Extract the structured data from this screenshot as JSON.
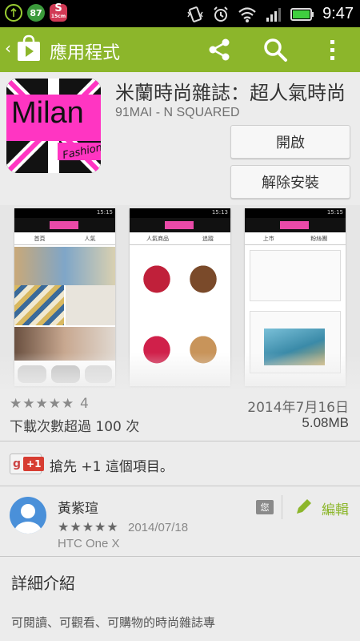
{
  "status_bar": {
    "time": "9:47",
    "notification_badge": "87",
    "notification_s": "S",
    "notification_s_sub": "15cm"
  },
  "action_bar": {
    "back_glyph": "‹",
    "title": "應用程式",
    "icons": [
      "share-icon",
      "search-icon",
      "overflow-menu-icon"
    ],
    "accent_color": "#8cb62b"
  },
  "app": {
    "title": "米蘭時尚雜誌：超人氣時尚",
    "developer": "91MAI - N SQUARED",
    "icon_text": "Milan",
    "icon_subtext": "Fashion",
    "open_label": "開啟",
    "uninstall_label": "解除安裝"
  },
  "screenshots": [
    {
      "time": "15:15",
      "tab1": "首頁",
      "tab2": "人氣"
    },
    {
      "time": "15:13",
      "tab1": "人氣商品",
      "tab2": "追蹤"
    },
    {
      "time": "15:15",
      "tab1": "上市",
      "tab2": "粉絲團"
    }
  ],
  "meta": {
    "stars": "★★★★★",
    "rating_count": "4",
    "updated": "2014年7月16日",
    "downloads": "下載次數超過 100 次",
    "size": "5.08MB"
  },
  "plusone": {
    "g": "g",
    "label": "+1",
    "text": "搶先 +1 這個項目。"
  },
  "review": {
    "user": "黃紫瑄",
    "stars": "★★★★★",
    "date": "2014/07/18",
    "device": "HTC One X",
    "you_badge": "您",
    "edit_label": "編輯"
  },
  "details": {
    "title": "詳細介紹",
    "line1": "可閱讀、可觀看、可購物的時尚雜誌專"
  }
}
